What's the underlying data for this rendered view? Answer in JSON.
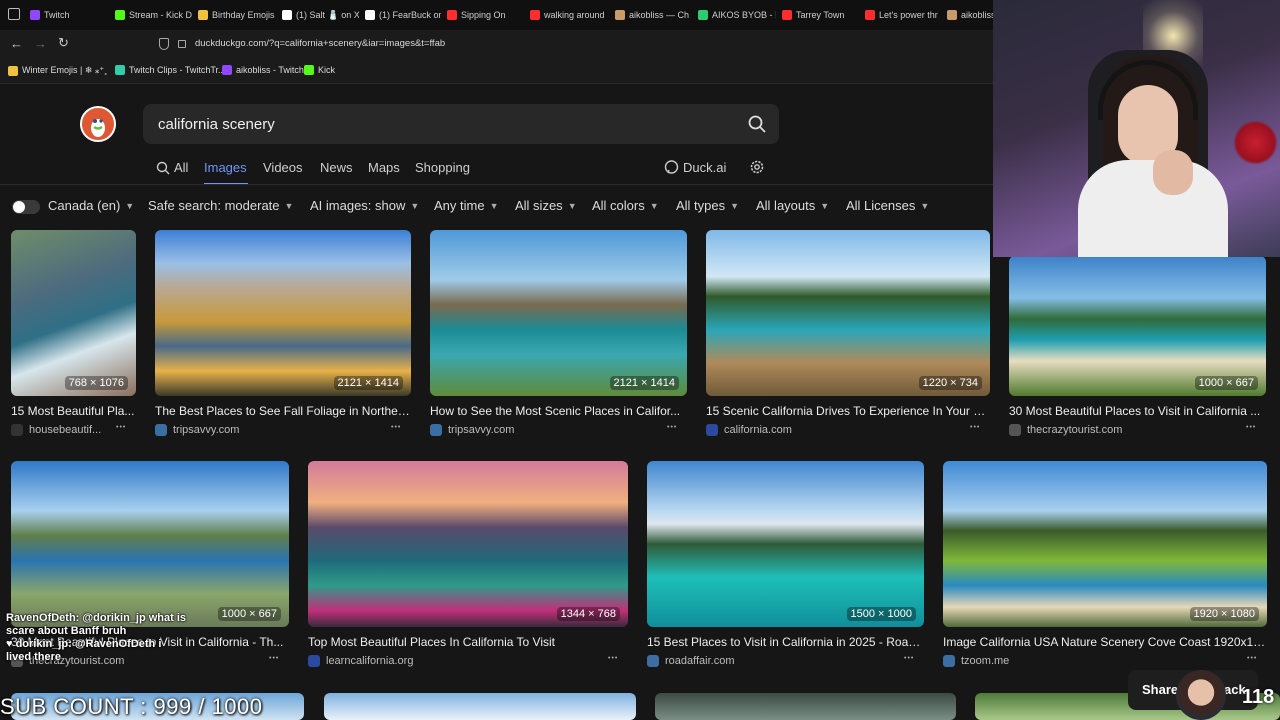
{
  "browser": {
    "tabs": [
      {
        "label": "Twitch",
        "color": "#9146ff"
      },
      {
        "label": "Stream - Kick D",
        "color": "#53fc18"
      },
      {
        "label": "Birthday Emojis",
        "color": "#f0c040"
      },
      {
        "label": "(1) Salt 🧂 on X",
        "color": "#ffffff"
      },
      {
        "label": "(1) FearBuck on",
        "color": "#ffffff"
      },
      {
        "label": "Sipping On",
        "color": "#ff2d2d"
      },
      {
        "label": "walking around",
        "color": "#ff2d2d"
      },
      {
        "label": "aikobliss — Ch",
        "color": "#c89b6a"
      },
      {
        "label": "AIKOS BYOB - !",
        "color": "#2ecc71"
      },
      {
        "label": "Tarrey Town",
        "color": "#ff2d2d"
      },
      {
        "label": "Let's power thr",
        "color": "#ff2d2d"
      },
      {
        "label": "aikobliss",
        "color": "#c89b6a"
      }
    ],
    "url": "duckduckgo.com/?q=california+scenery&iar=images&t=ffab",
    "bookmarks": [
      {
        "label": "Winter Emojis | ❄ ⁎⁺˳",
        "color": "#f0c040"
      },
      {
        "label": "Twitch Clips - TwitchTr...",
        "color": "#33ccaa"
      },
      {
        "label": "aikobliss - Twitch",
        "color": "#9146ff"
      },
      {
        "label": "Kick",
        "color": "#53fc18"
      }
    ]
  },
  "search": {
    "query": "california scenery"
  },
  "nav": {
    "tabs": [
      "All",
      "Images",
      "Videos",
      "News",
      "Maps",
      "Shopping"
    ],
    "active": "Images",
    "duckai": "Duck.ai"
  },
  "filters": {
    "region": "Canada (en)",
    "safe": "Safe search: moderate",
    "ai_images": "AI images: show",
    "time": "Any time",
    "sizes": "All sizes",
    "colors": "All colors",
    "types": "All types",
    "layouts": "All layouts",
    "licenses": "All Licenses"
  },
  "results": [
    {
      "title": "15 Most Beautiful Pla...",
      "source": "housebeautif...",
      "dims": "768 × 1076",
      "fav": "#333"
    },
    {
      "title": "The Best Places to See Fall Foliage in Norther...",
      "source": "tripsavvy.com",
      "dims": "2121 × 1414",
      "fav": "#3a6ea5"
    },
    {
      "title": "How to See the Most Scenic Places in Califor...",
      "source": "tripsavvy.com",
      "dims": "2121 × 1414",
      "fav": "#3a6ea5"
    },
    {
      "title": "15 Scenic California Drives To Experience In Your Li...",
      "source": "california.com",
      "dims": "1220 × 734",
      "fav": "#2a4aa0"
    },
    {
      "title": "30 Most Beautiful Places to Visit in California ...",
      "source": "thecrazytourist.com",
      "dims": "1000 × 667",
      "fav": "#555"
    },
    {
      "title": "30 Most Beautiful Places to Visit in California - Th...",
      "source": "thecrazytourist.com",
      "dims": "1000 × 667",
      "fav": "#555"
    },
    {
      "title": "Top Most Beautiful Places In California To Visit",
      "source": "learncalifornia.org",
      "dims": "1344 × 768",
      "fav": "#2a4aa0"
    },
    {
      "title": "15 Best Places to Visit in California in 2025 - Road ...",
      "source": "roadaffair.com",
      "dims": "1500 × 1000",
      "fav": "#3a6ea5"
    },
    {
      "title": "Image California USA Nature Scenery Cove Coast 1920x10...",
      "source": "tzoom.me",
      "dims": "1920 × 1080",
      "fav": "#3a6ea5"
    }
  ],
  "overlay": {
    "chat": [
      "RavenOfDeth: @dorikin_jp what is",
      "scare about Banff bruh",
      "♥ dorikin_jp: @RavenOfDeth i",
      "lived there"
    ],
    "subcount": "SUB COUNT : 999 / 1000",
    "share": "Share",
    "share_suffix": "ack",
    "counter": "118"
  }
}
